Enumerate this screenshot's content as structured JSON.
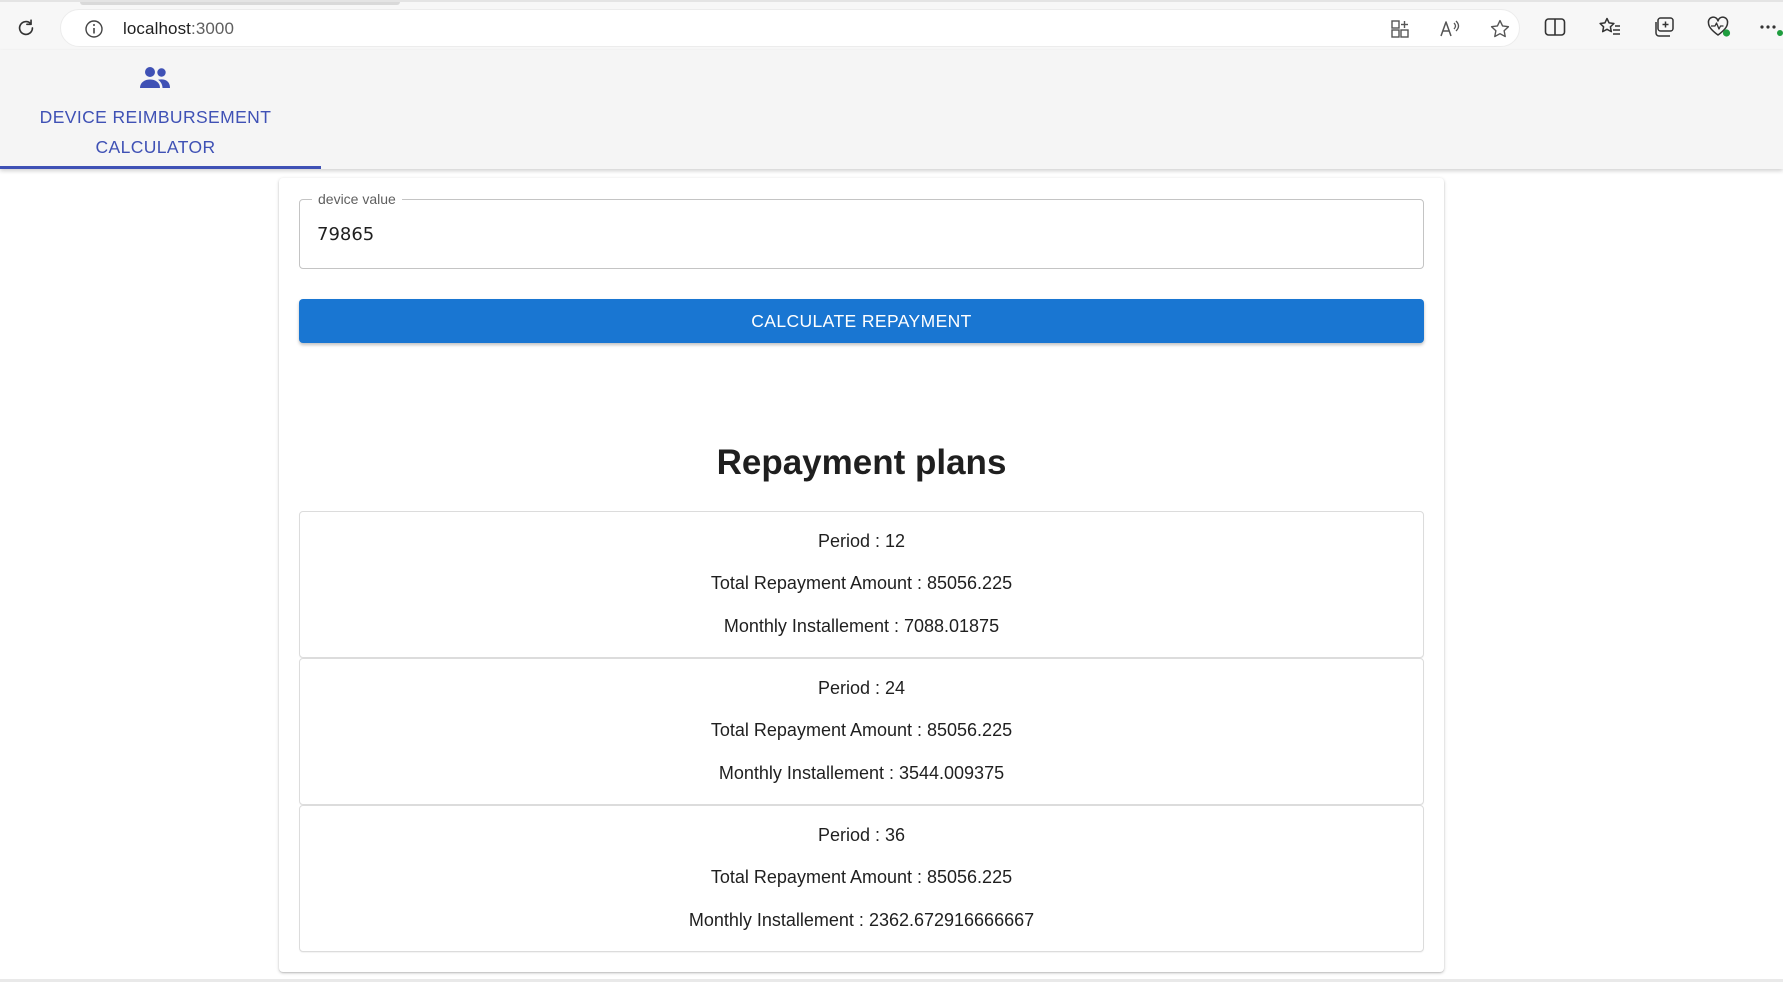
{
  "browser": {
    "url_host": "localhost",
    "url_port": ":3000"
  },
  "nav": {
    "tab_label": "DEVICE REIMBURSEMENT CALCULATOR",
    "tab_icon": "people-icon",
    "active_color": "#3f51b5"
  },
  "form": {
    "device_value_label": "device value",
    "device_value": "79865",
    "calculate_label": "CALCULATE REPAYMENT",
    "button_color": "#1976d2"
  },
  "plans": {
    "title": "Repayment plans",
    "items": [
      {
        "period": "Period : 12",
        "total": "Total Repayment Amount : 85056.225",
        "monthly": "Monthly Installement : 7088.01875"
      },
      {
        "period": "Period : 24",
        "total": "Total Repayment Amount : 85056.225",
        "monthly": "Monthly Installement : 3544.009375"
      },
      {
        "period": "Period : 36",
        "total": "Total Repayment Amount : 85056.225",
        "monthly": "Monthly Installement : 2362.672916666667"
      }
    ]
  }
}
